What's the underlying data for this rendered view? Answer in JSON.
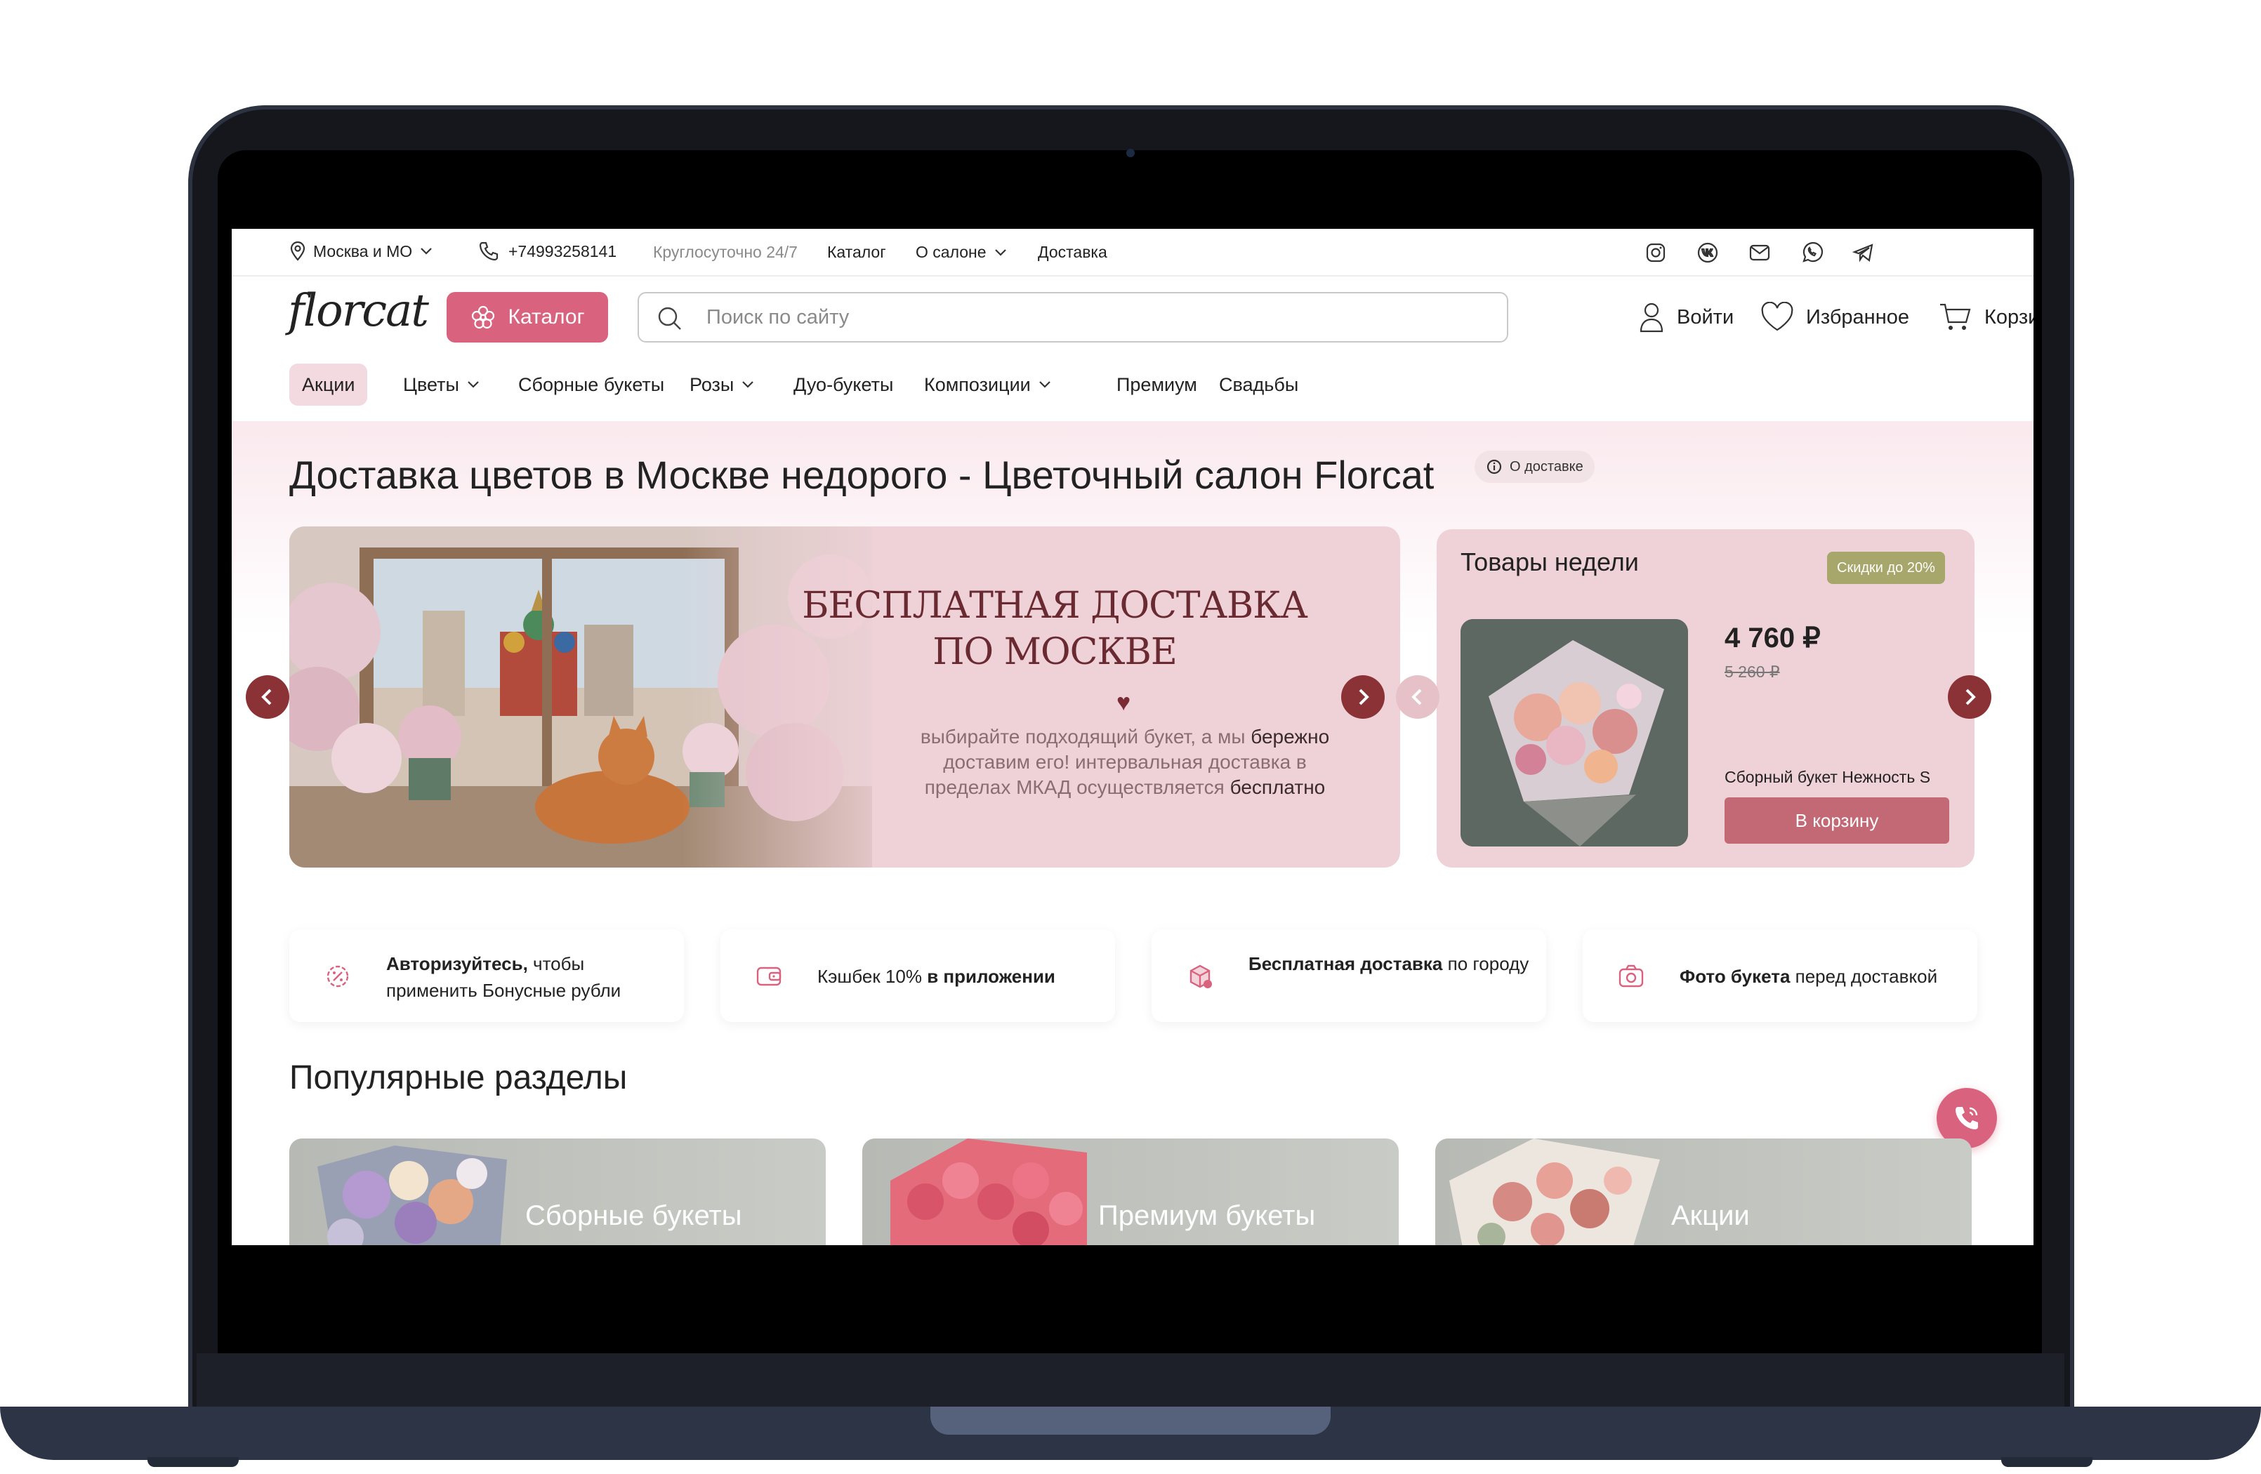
{
  "topbar": {
    "region": "Москва и МО",
    "phone": "+74993258141",
    "hours": "Круглосуточно 24/7",
    "links": [
      "Каталог",
      "О салоне",
      "Доставка"
    ]
  },
  "header": {
    "logo": "florcat",
    "catalog_button": "Каталог",
    "search_placeholder": "Поиск по сайту",
    "login": "Войти",
    "favorites": "Избранное",
    "cart": "Корзина"
  },
  "nav": [
    "Акции",
    "Цветы",
    "Сборные букеты",
    "Розы",
    "Дуо-букеты",
    "Композиции",
    "Премиум",
    "Свадьбы"
  ],
  "page": {
    "title": "Доставка цветов в Москве недорого - Цветочный салон Florcat",
    "delivery_pill": "О доставке"
  },
  "banner": {
    "title_line1": "БЕСПЛАТНАЯ ДОСТАВКА",
    "title_line2": "ПО МОСКВЕ",
    "text_1": "выбирайте подходящий букет, а мы ",
    "text_2": "бережно",
    "text_3": " доставим его! интервальная доставка в пределах МКАД осуществляется ",
    "text_4": "бесплатно"
  },
  "weekly": {
    "title": "Товары недели",
    "badge": "Скидки до 20%",
    "price": "4 760 ₽",
    "old_price": "5 260 ₽",
    "product_name": "Сборный букет Нежность S",
    "cart_button": "В корзину"
  },
  "features": [
    {
      "bold": "Авторизуйтесь,",
      "text": " чтобы применить Бонусные рубли"
    },
    {
      "text": "Кэшбек 10% ",
      "bold": "в приложении"
    },
    {
      "bold": "Бесплатная доставка",
      "text": " по городу"
    },
    {
      "bold": "Фото букета",
      "text": " перед доставкой"
    }
  ],
  "popular": {
    "title": "Популярные разделы",
    "cards": [
      "Сборные букеты",
      "Премиум букеты",
      "Акции"
    ]
  },
  "colors": {
    "accent": "#d9637e",
    "banner_bg": "#efd2d8",
    "cart_button": "#c36875",
    "badge": "#a7a66b",
    "arrow": "#8a3236"
  }
}
